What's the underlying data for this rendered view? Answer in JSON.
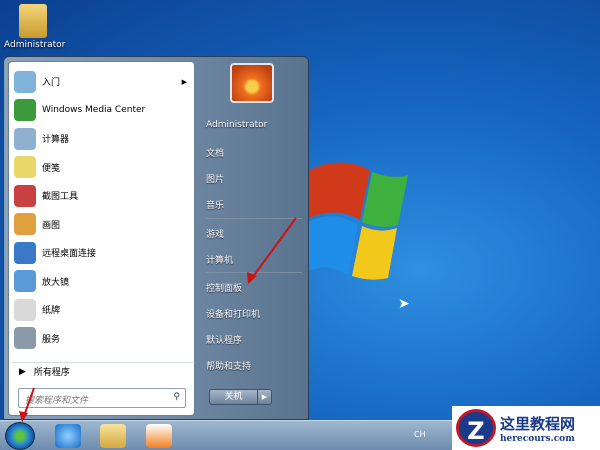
{
  "desktop": {
    "icon_label": "Administrator"
  },
  "start_menu": {
    "programs": [
      {
        "label": "入门",
        "has_submenu": true,
        "color": "#7fb3d9"
      },
      {
        "label": "Windows Media Center",
        "color": "#3c9a3c"
      },
      {
        "label": "计算器",
        "color": "#8fb0cf"
      },
      {
        "label": "便笺",
        "color": "#e8d86a"
      },
      {
        "label": "截图工具",
        "color": "#c94040"
      },
      {
        "label": "画图",
        "color": "#e0a040"
      },
      {
        "label": "远程桌面连接",
        "color": "#3a78c8"
      },
      {
        "label": "放大镜",
        "color": "#5a9ad8"
      },
      {
        "label": "纸牌",
        "color": "#d9d9d9"
      },
      {
        "label": "服务",
        "color": "#8a9aa8"
      }
    ],
    "all_programs": "所有程序",
    "search_placeholder": "搜索程序和文件",
    "right_items": [
      "Administrator",
      "文档",
      "图片",
      "音乐",
      "游戏",
      "计算机",
      "控制面板",
      "设备和打印机",
      "默认程序",
      "帮助和支持"
    ],
    "shutdown": "关机"
  },
  "tray": {
    "lang": "CH"
  },
  "watermark": {
    "title": "这里教程网",
    "url": "herecours.com",
    "logo": "Z"
  }
}
